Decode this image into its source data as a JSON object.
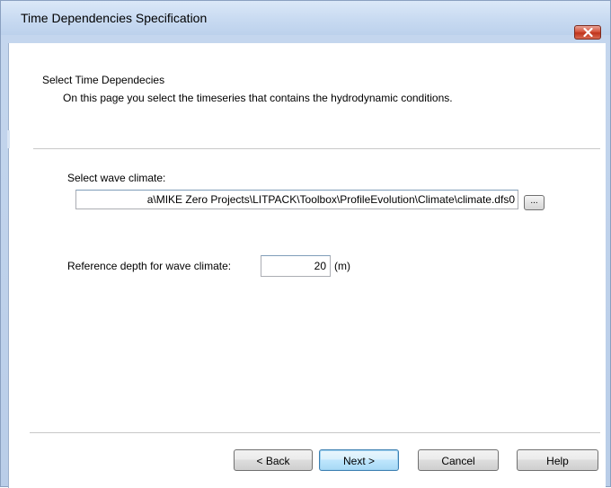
{
  "window": {
    "title": "Time Dependencies Specification",
    "close_icon": "close-x-icon"
  },
  "header": {
    "title": "Select Time Dependecies",
    "subtitle": "On this page you select the timeseries that contains the hydrodynamic conditions."
  },
  "wave_climate": {
    "label": "Select wave climate:",
    "path_value": "a\\MIKE Zero Projects\\LITPACK\\Toolbox\\ProfileEvolution\\Climate\\climate.dfs0",
    "browse_label": "..."
  },
  "reference_depth": {
    "label": "Reference depth for wave climate:",
    "value": "20",
    "unit": "(m)"
  },
  "buttons": {
    "back": "< Back",
    "next": "Next >",
    "cancel": "Cancel",
    "help": "Help"
  },
  "colors": {
    "close_button": "#c0341b",
    "title_bar": "#c8daf1",
    "default_button_border": "#3c7fb1"
  }
}
